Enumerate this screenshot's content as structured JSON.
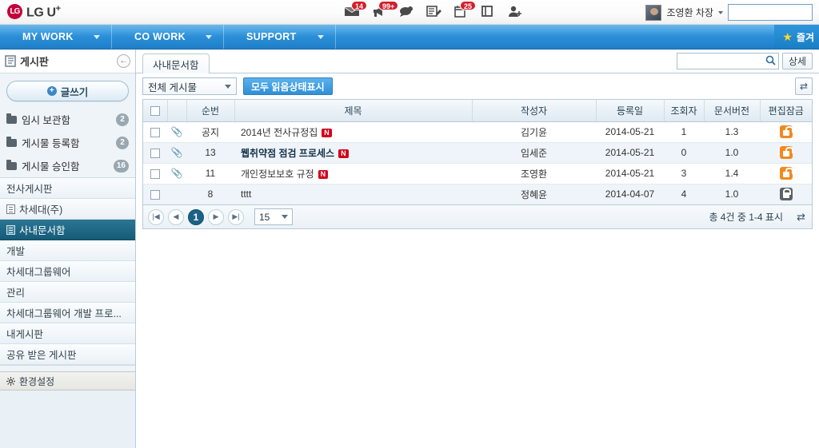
{
  "topbar": {
    "logo_mark": "LG",
    "logo_text": "LG U",
    "logo_sup": "+",
    "icons": [
      {
        "name": "mail-icon",
        "badge": "14"
      },
      {
        "name": "megaphone-icon",
        "badge": "99+"
      },
      {
        "name": "chat-icon",
        "badge": ""
      },
      {
        "name": "memo-icon",
        "badge": ""
      },
      {
        "name": "calendar-icon",
        "badge": "25"
      },
      {
        "name": "book-icon",
        "badge": ""
      },
      {
        "name": "add-user-icon",
        "badge": ""
      }
    ],
    "user_name": "조영환 차장",
    "user_input_value": "",
    "user_input_placeholder": ""
  },
  "nav": {
    "items": [
      {
        "label": "MY WORK"
      },
      {
        "label": "CO WORK"
      },
      {
        "label": "SUPPORT"
      }
    ],
    "favorite_label": "즐겨"
  },
  "sidebar": {
    "title": "게시판",
    "collapse_icon": "←",
    "write_label": "글쓰기",
    "folders": [
      {
        "label": "임시 보관함",
        "count": "2"
      },
      {
        "label": "게시물 등록함",
        "count": "2"
      },
      {
        "label": "게시물 승인함",
        "count": "16"
      }
    ],
    "boards": [
      {
        "label": "전사게시판",
        "icon": false,
        "active": false
      },
      {
        "label": "차세대(주)",
        "icon": true,
        "active": false
      },
      {
        "label": "사내문서함",
        "icon": true,
        "active": true
      },
      {
        "label": "개발",
        "icon": false,
        "active": false
      },
      {
        "label": "차세대그룹웨어",
        "icon": false,
        "active": false
      },
      {
        "label": "관리",
        "icon": false,
        "active": false
      },
      {
        "label": "차세대그룹웨어 개발 프로...",
        "icon": false,
        "active": false
      },
      {
        "label": "내게시판",
        "icon": false,
        "active": false
      },
      {
        "label": "공유 받은 게시판",
        "icon": false,
        "active": false
      }
    ],
    "settings_label": "환경설정"
  },
  "main": {
    "tab_label": "사내문서함",
    "search_value": "",
    "search_placeholder": "",
    "detail_button": "상세",
    "filter_label": "전체 게시물",
    "mark_all_read_label": "모두 읽음상태표시",
    "refresh_icon": "⇄"
  },
  "table": {
    "columns": [
      "",
      "",
      "순번",
      "제목",
      "작성자",
      "등록일",
      "조회자",
      "문서버전",
      "편집잠금"
    ],
    "rows": [
      {
        "attach": true,
        "no": "공지",
        "title": "2014년 전사규정집",
        "new": true,
        "bold": false,
        "author": "김기윤",
        "date": "2014-05-21",
        "views": "1",
        "version": "1.3",
        "lock": "open"
      },
      {
        "attach": true,
        "no": "13",
        "title": "웹취약점 점검 프로세스",
        "new": true,
        "bold": true,
        "author": "임세준",
        "date": "2014-05-21",
        "views": "0",
        "version": "1.0",
        "lock": "open"
      },
      {
        "attach": true,
        "no": "11",
        "title": "개인정보보호 규정",
        "new": true,
        "bold": false,
        "author": "조영환",
        "date": "2014-05-21",
        "views": "3",
        "version": "1.4",
        "lock": "open"
      },
      {
        "attach": false,
        "no": "8",
        "title": "tttt",
        "new": false,
        "bold": false,
        "author": "정혜윤",
        "date": "2014-04-07",
        "views": "4",
        "version": "1.0",
        "lock": "closed"
      }
    ]
  },
  "pager": {
    "first": "|◀",
    "prev": "◀",
    "current": "1",
    "next": "▶",
    "last": "▶|",
    "page_size": "15",
    "status": "총 4건 중 1-4 표시",
    "refresh_icon": "⇄"
  },
  "colors": {
    "accent_blue": "#2b90d9",
    "active_board": "#1c6285",
    "badge_red": "#d31f2b",
    "lock_open": "#f08a1e",
    "lock_closed": "#5a6167",
    "star_yellow": "#ffd530"
  }
}
